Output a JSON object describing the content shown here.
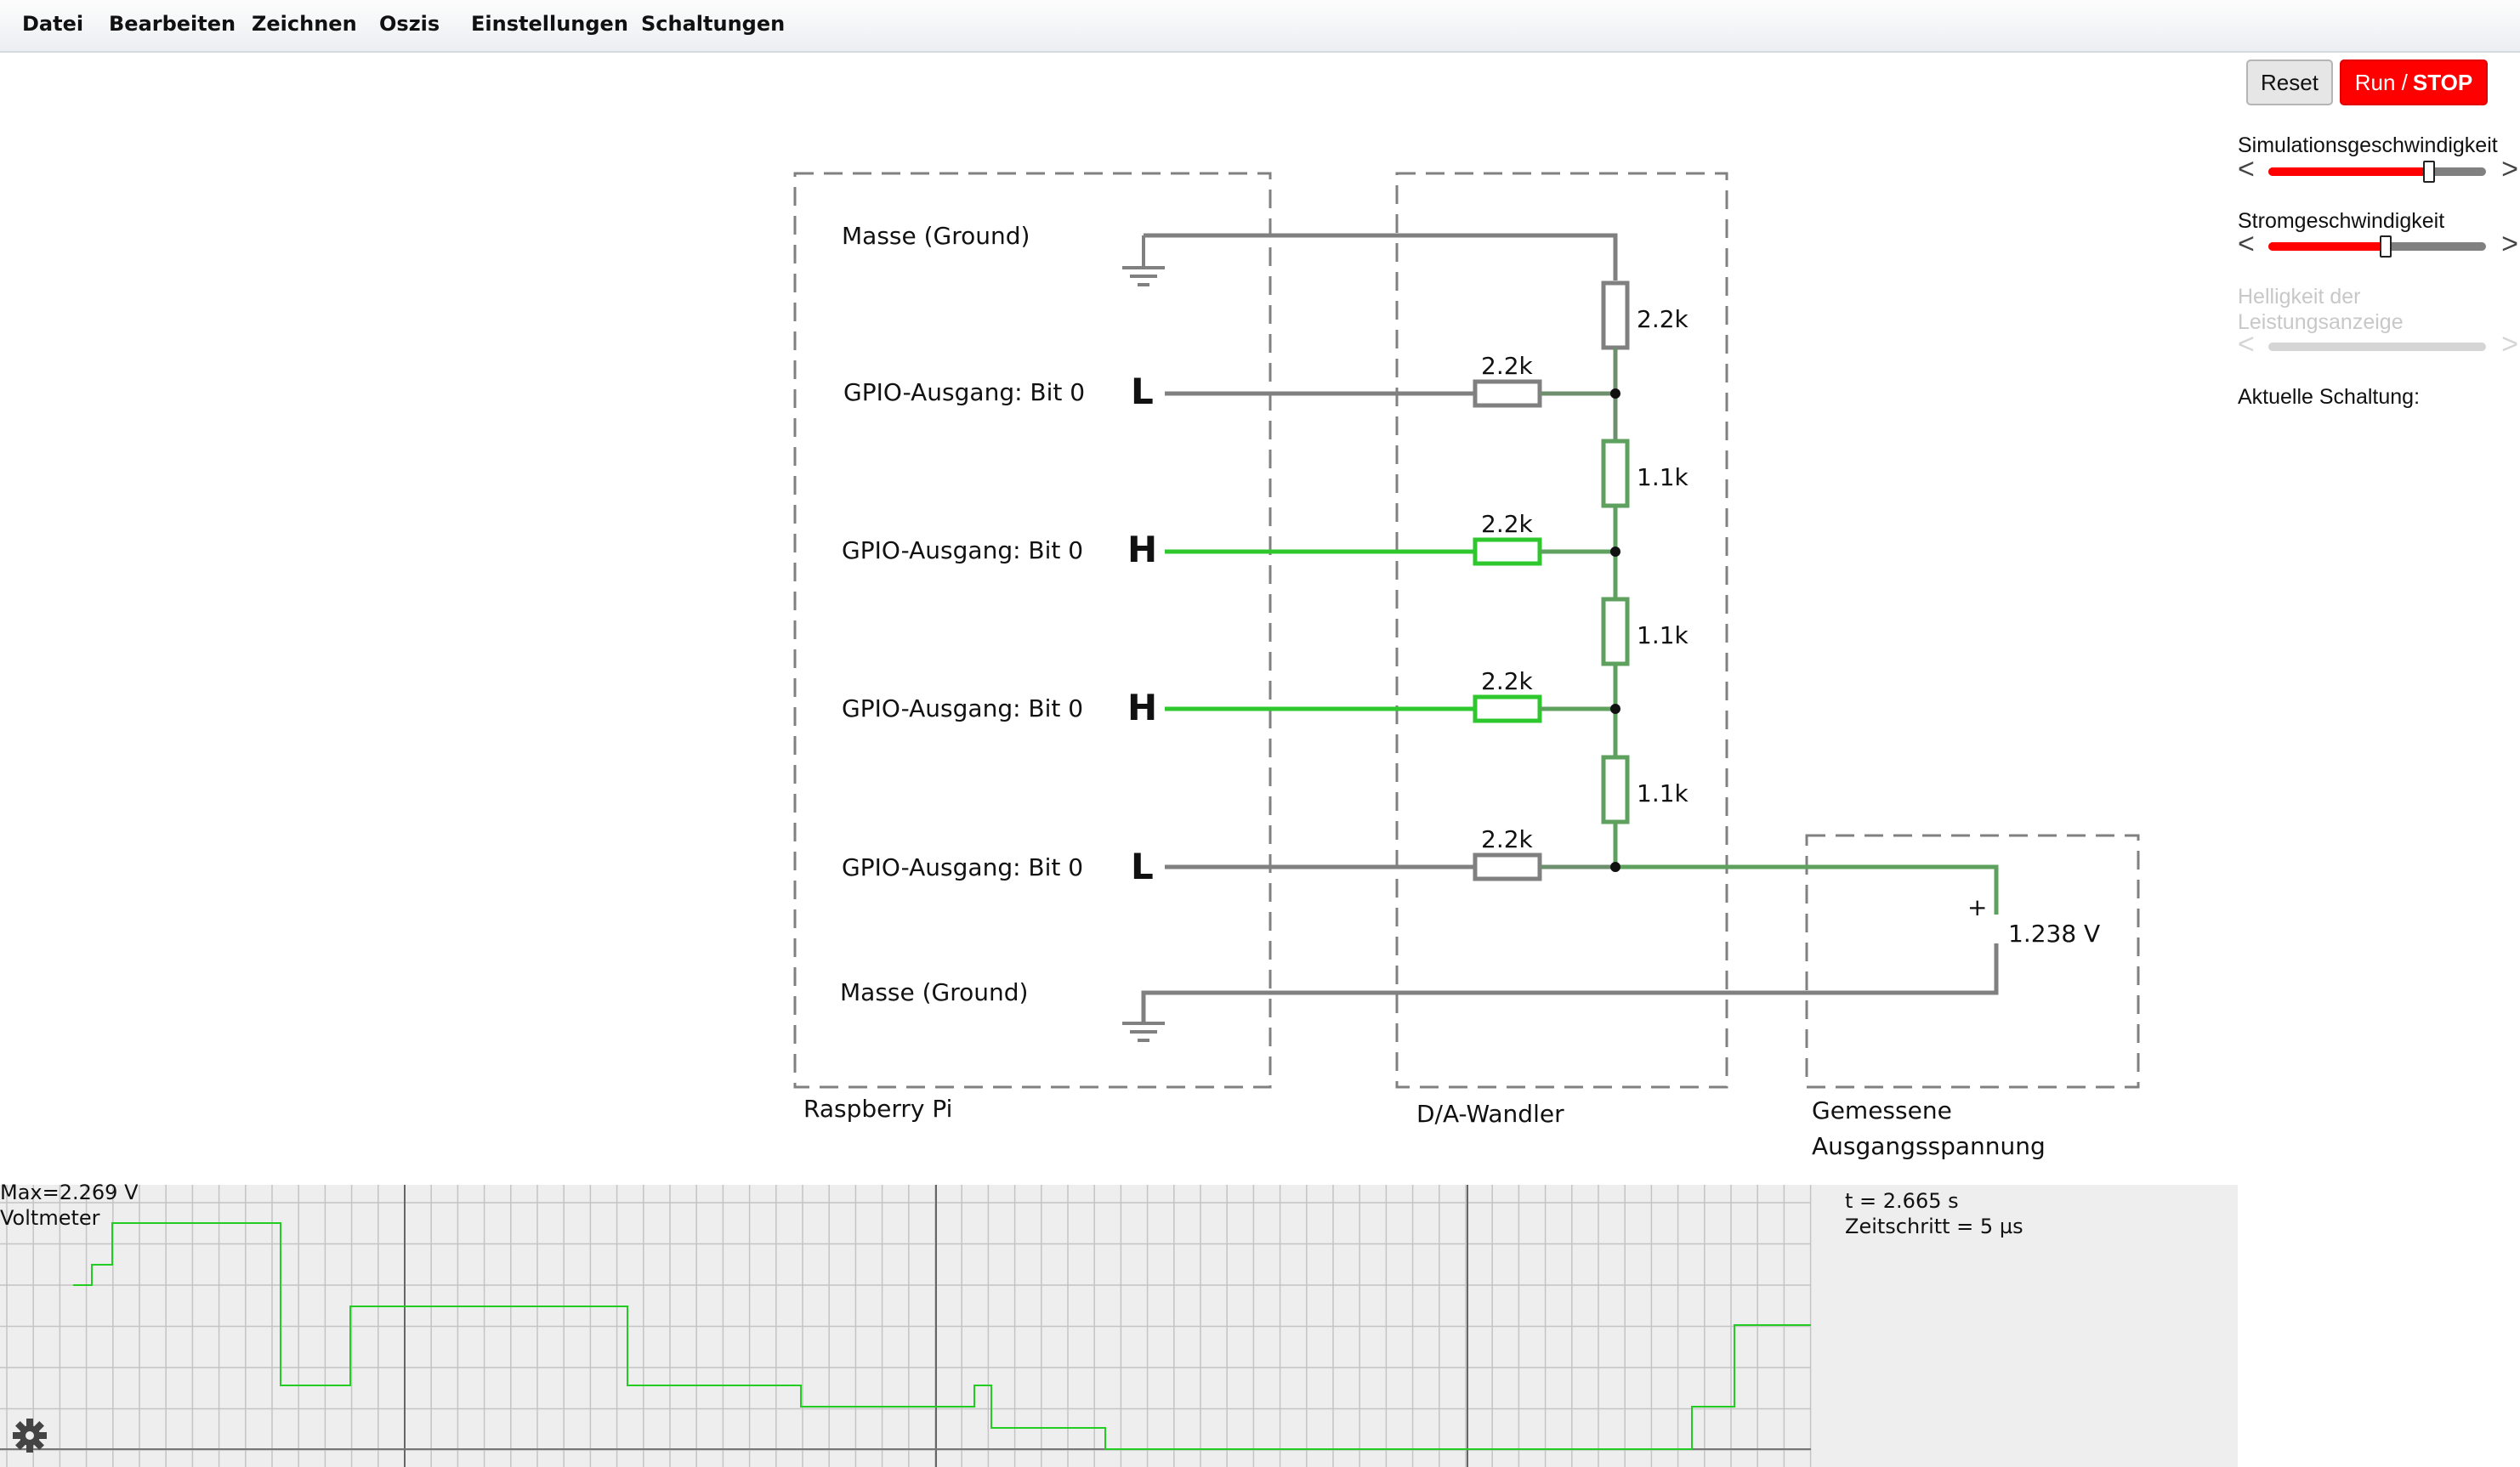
{
  "menu": [
    "Datei",
    "Bearbeiten",
    "Zeichnen",
    "Oszis",
    "Einstellungen",
    "Schaltungen"
  ],
  "buttons": {
    "reset": "Reset",
    "run": "Run /",
    "stop": "STOP"
  },
  "sidebar": {
    "sim_speed_label": "Simulationsgeschwindigkeit",
    "sim_speed_level": 0.74,
    "current_speed_label": "Stromgeschwindigkeit",
    "current_speed_level": 0.54,
    "brightness_label_1": "Helligkeit der",
    "brightness_label_2": "Leistungsanzeige",
    "current_circuit_label": "Aktuelle Schaltung:"
  },
  "circuit": {
    "ground_top": "Masse (Ground)",
    "ground_bottom": "Masse (Ground)",
    "gpio_label": "GPIO-Ausgang: Bit 0",
    "gpio_states": [
      "L",
      "H",
      "H",
      "L"
    ],
    "resistor_horizontal": "2.2k",
    "resistor_ladder": [
      "2.2k",
      "1.1k",
      "1.1k",
      "1.1k"
    ],
    "box_raspberry": "Raspberry Pi",
    "box_dac": "D/A-Wandler",
    "box_output_1": "Gemessene",
    "box_output_2": "Ausgangsspannung",
    "voltmeter_plus": "+",
    "voltmeter_value": "1.238 V"
  },
  "scope": {
    "max_label": "Max=2.269 V",
    "name": "Voltmeter",
    "time": "t = 2.665 s",
    "timestep": "Zeitschritt = 5 µs"
  },
  "colors": {
    "wire_off": "#808080",
    "wire_on": "#2ec82e",
    "wire_mid": "#5ea05e",
    "stop_red": "#ff0000",
    "scope_trace": "#22cc22",
    "scope_bg": "#eeeeee"
  }
}
